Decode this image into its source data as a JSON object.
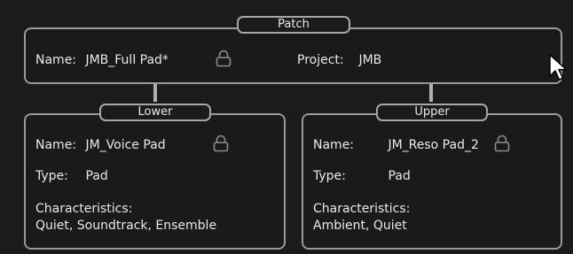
{
  "patch": {
    "title": "Patch",
    "name_label": "Name:",
    "name_value": "JMB_Full Pad*",
    "project_label": "Project:",
    "project_value": "JMB"
  },
  "lower": {
    "title": "Lower",
    "name_label": "Name:",
    "name_value": "JM_Voice Pad",
    "type_label": "Type:",
    "type_value": "Pad",
    "characteristics_label": "Characteristics:",
    "characteristics_value": "Quiet, Soundtrack, Ensemble"
  },
  "upper": {
    "title": "Upper",
    "name_label": "Name:",
    "name_value": "JM_Reso Pad_2",
    "type_label": "Type:",
    "type_value": "Pad",
    "characteristics_label": "Characteristics:",
    "characteristics_value": "Ambient, Quiet"
  },
  "colors": {
    "background": "#1b1b1b",
    "border": "#9a9a9a",
    "text": "#e6e6e6"
  },
  "icons": [
    "lock-icon",
    "mouse-cursor-icon"
  ]
}
